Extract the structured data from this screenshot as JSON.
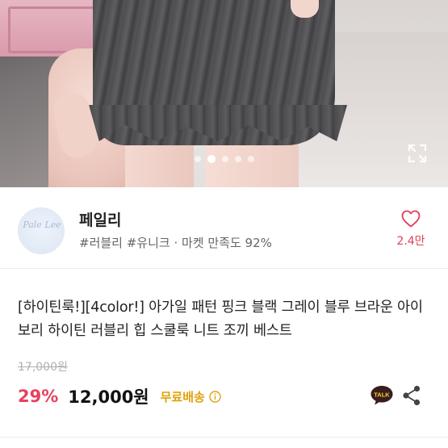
{
  "gallery": {
    "total_images": 5,
    "active_index": 1,
    "expand_icon": "expand-icon"
  },
  "seller": {
    "name": "페일리",
    "avatar_text": "Pale Lee",
    "tags": "#러블리 #유니크 · 마켓 만족도 92%",
    "likes": "2.4만"
  },
  "product": {
    "title": "[하이틴룩!][4color!] 아가일 패턴 핑크 블랙 그레이 블루 브라운 아이보리 하이틴 러블리 힙 스쿨룩 니트 조끼 베스트",
    "original_price": "17,000원",
    "discount": "29%",
    "price": "12,000원",
    "shipping": "무료배송"
  },
  "actions": {
    "talk_label": "TALK"
  },
  "colors": {
    "accent": "#e8405e",
    "shipping": "#e0a20c",
    "talk_bubble": "#3a1d1d"
  }
}
